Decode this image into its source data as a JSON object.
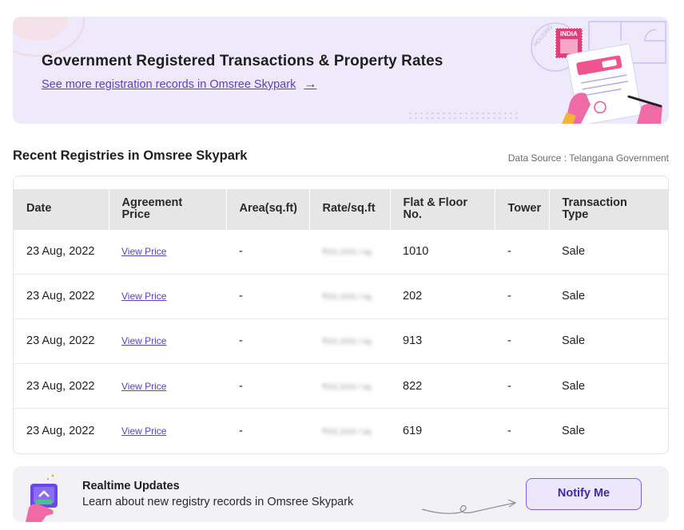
{
  "banner": {
    "title": "Government Registered Transactions & Property Rates",
    "link_label": "See more registration records in Omsree Skypark",
    "link_arrow": "→",
    "stamp_text": "INDIA"
  },
  "section": {
    "title": "Recent Registries in Omsree Skypark",
    "data_source": "Data Source : Telangana Government"
  },
  "table": {
    "headers": [
      "Date",
      "Agreement Price",
      "Area(sq.ft)",
      "Rate/sq.ft",
      "Flat & Floor No.",
      "Tower",
      "Transaction Type"
    ],
    "rows": [
      {
        "date": "23 Aug, 2022",
        "price": "View Price",
        "area": "-",
        "rate": "₹XX,XXX / sq",
        "flat": "1010",
        "tower": "-",
        "type": "Sale"
      },
      {
        "date": "23 Aug, 2022",
        "price": "View Price",
        "area": "-",
        "rate": "₹XX,XXX / sq",
        "flat": "202",
        "tower": "-",
        "type": "Sale"
      },
      {
        "date": "23 Aug, 2022",
        "price": "View Price",
        "area": "-",
        "rate": "₹XX,XXX / sq",
        "flat": "913",
        "tower": "-",
        "type": "Sale"
      },
      {
        "date": "23 Aug, 2022",
        "price": "View Price",
        "area": "-",
        "rate": "₹XX,XXX / sq",
        "flat": "822",
        "tower": "-",
        "type": "Sale"
      },
      {
        "date": "23 Aug, 2022",
        "price": "View Price",
        "area": "-",
        "rate": "₹XX,XXX / sq",
        "flat": "619",
        "tower": "-",
        "type": "Sale"
      }
    ]
  },
  "notify": {
    "title": "Realtime Updates",
    "subtitle": "Learn about new registry records in Omsree Skypark",
    "button_label": "Notify Me"
  },
  "colors": {
    "accent": "#5a3fc0",
    "banner_bg": "#efeafb",
    "header_bg": "#e6e6e6",
    "notify_bg": "#f1f1f6"
  }
}
